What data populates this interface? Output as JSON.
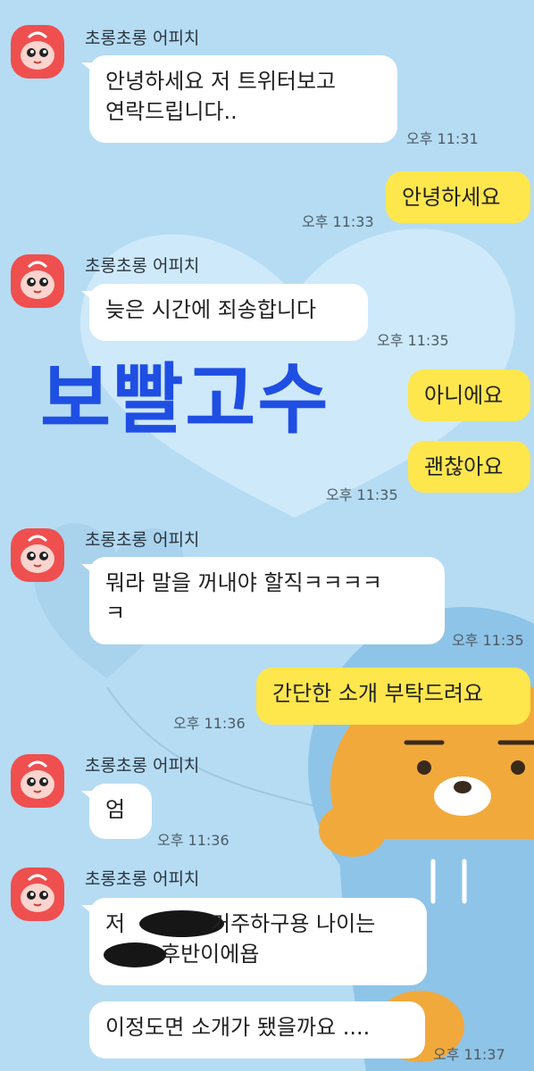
{
  "chat": {
    "sender_name": "초롱초롱 어피치",
    "overlay_text": "보빨고수",
    "messages": [
      {
        "text_lines": [
          "안녕하세요 저 트위터보고",
          "연락드립니다.."
        ],
        "time": "오후 11:31"
      },
      {
        "text": "안녕하세요",
        "time": "오후 11:33"
      },
      {
        "text": "늦은 시간에 죄송합니다",
        "time": "오후 11:35"
      },
      {
        "text": "아니에요"
      },
      {
        "text": "괜찮아요",
        "time": "오후 11:35"
      },
      {
        "text_lines": [
          "뭐라 말을 꺼내야 할직ㅋㅋㅋㅋ",
          "ㅋ"
        ],
        "time": "오후 11:35"
      },
      {
        "text": "간단한 소개 부탁드려요",
        "time": "오후 11:36"
      },
      {
        "text": "엄",
        "time": "오후 11:36"
      },
      {
        "text_lines": [
          "저",
          "거주하구용 나이는",
          "후반이에욥"
        ]
      },
      {
        "text": "이정도면 소개가 됐을까요 ....",
        "time": "오후 11:37"
      }
    ]
  },
  "colors": {
    "background": "#b5dcf3",
    "my_bubble": "#fee64d",
    "their_bubble": "#ffffff",
    "overlay_text": "#1f4ee3",
    "avatar_bg": "#ef4f4f"
  }
}
